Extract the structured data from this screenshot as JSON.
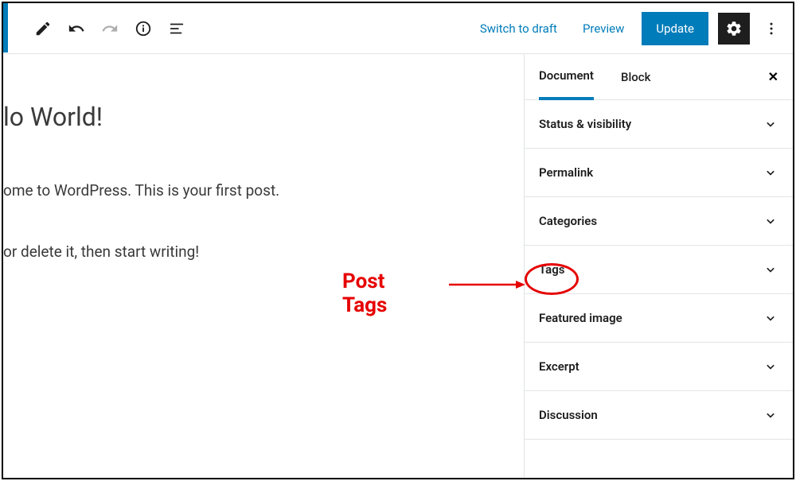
{
  "toolbar": {
    "switch_to_draft": "Switch to draft",
    "preview": "Preview",
    "update": "Update"
  },
  "editor": {
    "title": "lo World!",
    "paragraph1": "ome to WordPress. This is your first post.",
    "paragraph2": "or delete it, then start writing!"
  },
  "sidebar": {
    "tabs": {
      "document": "Document",
      "block": "Block"
    },
    "panels": [
      "Status & visibility",
      "Permalink",
      "Categories",
      "Tags",
      "Featured image",
      "Excerpt",
      "Discussion"
    ]
  },
  "annotation": {
    "label": "Post Tags"
  }
}
